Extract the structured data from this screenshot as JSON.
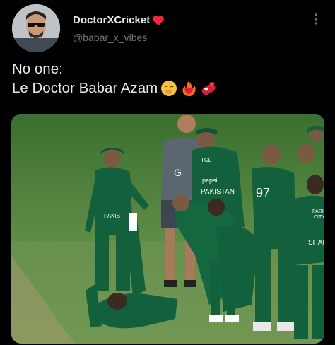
{
  "author": {
    "display_name": "DoctorXCricket",
    "handle": "@babar_x_vibes",
    "verified_emoji": "red-heart-icon"
  },
  "tweet": {
    "line1": "No one:",
    "line2": "Le Doctor Babar Azam",
    "emojis": [
      "shushing-face-icon",
      "heart-on-fire-icon",
      "hearts-pill-icon"
    ]
  },
  "media": {
    "subject": "cricket-players-photo",
    "jersey_texts": {
      "pepsi": "pepsi",
      "pakistan": "PAKISTAN",
      "tcl": "TCL",
      "pakistan_short": "PAKIS",
      "number": "97",
      "shad": "SHAD",
      "parkview": "PARKVI\nCITY"
    }
  },
  "colors": {
    "background": "#000000",
    "text": "#e7e9ea",
    "secondary": "#71767b",
    "jersey": "#12603c",
    "grass": "#4c7a3c"
  }
}
